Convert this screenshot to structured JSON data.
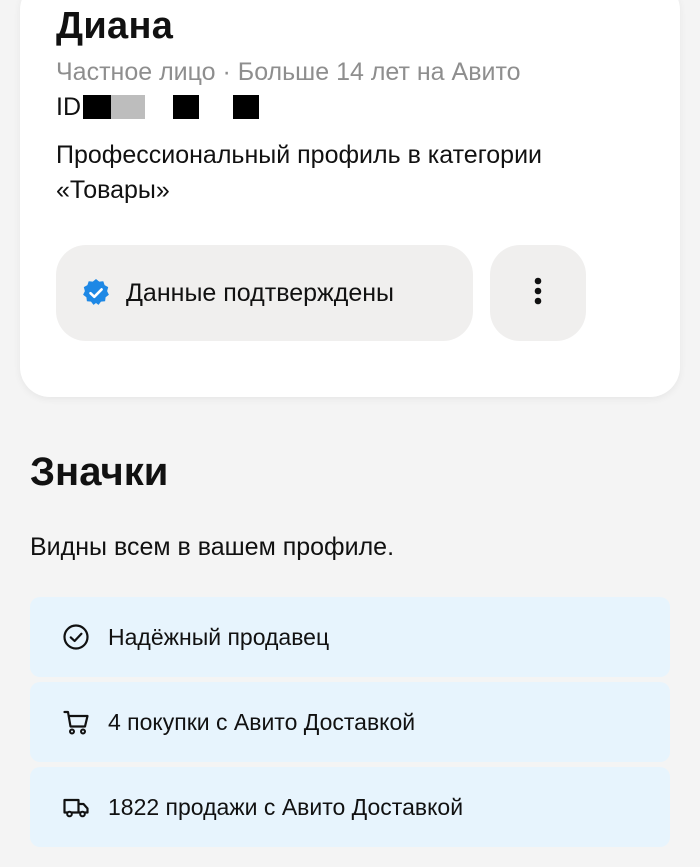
{
  "profile": {
    "name": "Диана",
    "meta": "Частное лицо · Больше 14 лет на Авито",
    "id_label": "ID",
    "category": "Профессиональный профиль в категории «Товары»",
    "verified_label": "Данные подтверждены",
    "verified_icon": "verified-badge-icon",
    "more_icon": "more-vertical-icon"
  },
  "badges": {
    "title": "Значки",
    "subtitle": "Видны всем в вашем профиле.",
    "items": [
      {
        "label": "Надёжный продавец",
        "icon": "check-circle-icon"
      },
      {
        "label": "4 покупки с Авито Доставкой",
        "icon": "cart-icon"
      },
      {
        "label": "1822 продажи с Авито Доставкой",
        "icon": "truck-icon"
      }
    ]
  },
  "colors": {
    "background": "#f4f4f4",
    "card": "#ffffff",
    "button_bg": "#f0efee",
    "badge_bg": "#e7f4fd",
    "verified_blue": "#1e88e5",
    "muted_text": "#8e8e8e"
  }
}
